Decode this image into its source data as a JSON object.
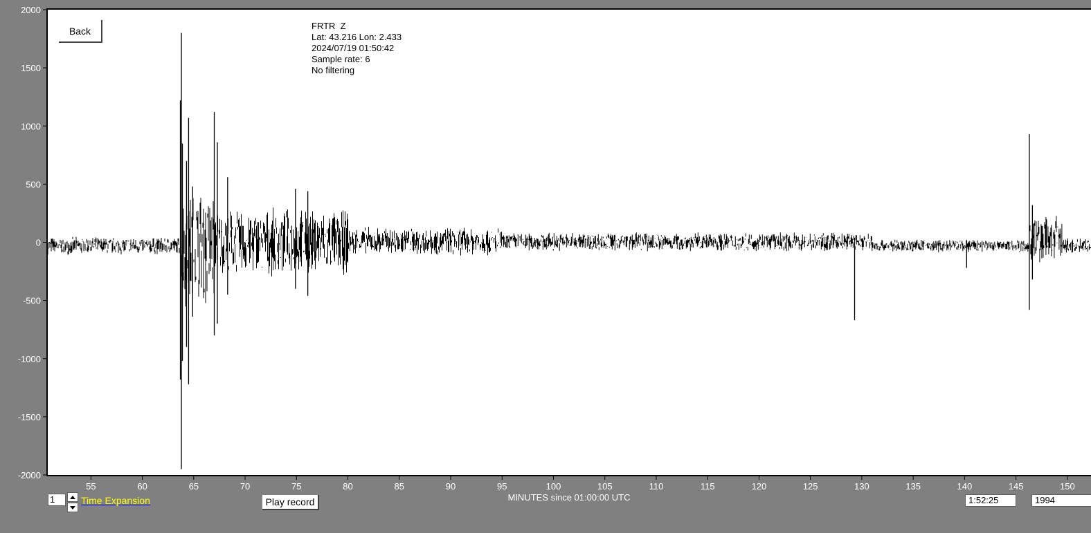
{
  "toolbar": {
    "back_label": "Back"
  },
  "station": {
    "name": "FRTR  Z",
    "location": "Lat: 43.216 Lon: 2.433",
    "datetime": "2024/07/19 01:50:42",
    "sample_rate": "Sample rate: 6",
    "filter": "No filtering"
  },
  "controls": {
    "time_expansion_value": "1",
    "time_expansion_label": "Time Expansion",
    "play_label": "Play record",
    "time_readout": "1:52:25",
    "count_readout": "1994"
  },
  "colors": {
    "background": "#808080",
    "plot_background": "#ffffff",
    "trace": "#000000",
    "axis_text": "#ffffff",
    "label_highlight": "#ffff00"
  },
  "chart_data": {
    "type": "line",
    "title": "",
    "xlabel": "MINUTES since 01:00:00 UTC",
    "ylabel": "",
    "xlim": [
      50.8,
      152.3
    ],
    "ylim": [
      -2000,
      2000
    ],
    "x_ticks": [
      "55",
      "60",
      "65",
      "70",
      "75",
      "80",
      "85",
      "90",
      "95",
      "100",
      "105",
      "110",
      "115",
      "120",
      "125",
      "130",
      "135",
      "140",
      "145",
      "150"
    ],
    "y_ticks": [
      "2000",
      "1500",
      "1000",
      "500",
      "0",
      "-500",
      "-1000",
      "-1500",
      "-2000"
    ],
    "grid": false,
    "series": [
      {
        "values": {
          "background_noise_band": [
            {
              "x_start": 50.8,
              "x_end": 63.8,
              "min": -110,
              "max": 50
            },
            {
              "x_start": 63.8,
              "x_end": 67.0,
              "min": -600,
              "max": 500
            },
            {
              "x_start": 67.0,
              "x_end": 80.0,
              "min": -300,
              "max": 300
            },
            {
              "x_start": 80.0,
              "x_end": 95.0,
              "min": -120,
              "max": 140
            },
            {
              "x_start": 95.0,
              "x_end": 131.0,
              "min": -80,
              "max": 90
            },
            {
              "x_start": 131.0,
              "x_end": 146.3,
              "min": -90,
              "max": 30
            },
            {
              "x_start": 146.3,
              "x_end": 149.5,
              "min": -200,
              "max": 250
            },
            {
              "x_start": 149.5,
              "x_end": 152.3,
              "min": -100,
              "max": 40
            }
          ],
          "spikes": [
            {
              "x": 63.7,
              "min": -1180,
              "max": 1220
            },
            {
              "x": 63.8,
              "min": -1950,
              "max": 1800
            },
            {
              "x": 63.9,
              "min": -1020,
              "max": 850
            },
            {
              "x": 64.3,
              "min": -900,
              "max": 700
            },
            {
              "x": 64.5,
              "min": -1220,
              "max": 1070
            },
            {
              "x": 64.9,
              "min": -640,
              "max": 480
            },
            {
              "x": 67.0,
              "min": -800,
              "max": 1120
            },
            {
              "x": 67.3,
              "min": -700,
              "max": 860
            },
            {
              "x": 68.3,
              "min": -450,
              "max": 560
            },
            {
              "x": 74.9,
              "min": -400,
              "max": 460
            },
            {
              "x": 76.1,
              "min": -460,
              "max": 440
            },
            {
              "x": 129.3,
              "min": -670,
              "max": 40
            },
            {
              "x": 140.2,
              "min": -220,
              "max": 20
            },
            {
              "x": 146.3,
              "min": -580,
              "max": 930
            },
            {
              "x": 146.6,
              "min": -320,
              "max": 320
            }
          ]
        }
      }
    ]
  }
}
